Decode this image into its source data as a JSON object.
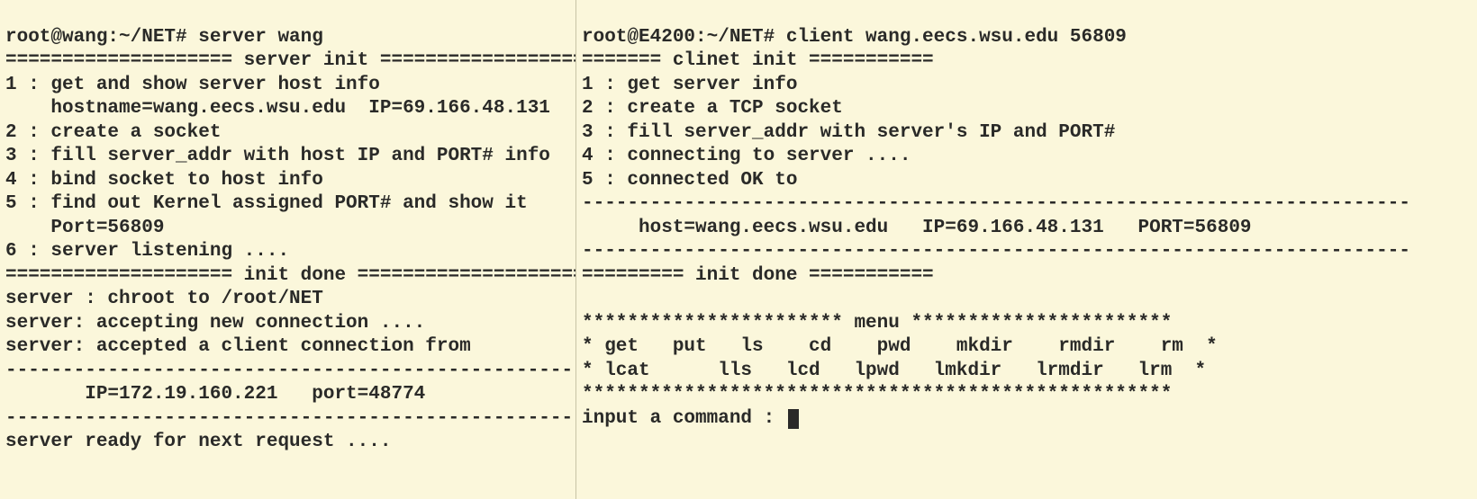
{
  "server": {
    "prompt": "root@wang:~/NET# server wang",
    "init_header": "==================== server init ===================",
    "steps": {
      "s1a": "1 : get and show server host info",
      "s1b": "    hostname=wang.eecs.wsu.edu  IP=69.166.48.131",
      "s2": "2 : create a socket",
      "s3": "3 : fill server_addr with host IP and PORT# info",
      "s4": "4 : bind socket to host info",
      "s5a": "5 : find out Kernel assigned PORT# and show it",
      "s5b": "    Port=56809",
      "s6": "6 : server listening ...."
    },
    "init_done": "==================== init done ====================",
    "chroot": "server : chroot to /root/NET",
    "accepting": "server: accepting new connection ....",
    "accepted": "server: accepted a client connection from",
    "dashes1": "---------------------------------------------------",
    "client_ip": "       IP=172.19.160.221   port=48774",
    "dashes2": "---------------------------------------------------",
    "ready": "server ready for next request ...."
  },
  "client": {
    "prompt": "root@E4200:~/NET# client wang.eecs.wsu.edu 56809",
    "init_header": "======= clinet init ===========",
    "steps": {
      "s1": "1 : get server info",
      "s2": "2 : create a TCP socket",
      "s3": "3 : fill server_addr with server's IP and PORT#",
      "s4": "4 : connecting to server ....",
      "s5": "5 : connected OK to"
    },
    "dashes1": "-------------------------------------------------------------------------",
    "host_line": "     host=wang.eecs.wsu.edu   IP=69.166.48.131   PORT=56809",
    "dashes2": "-------------------------------------------------------------------------",
    "init_done": "========= init done ===========",
    "blank": "",
    "menu_header": "*********************** menu ***********************",
    "menu_row1": "* get   put   ls    cd    pwd    mkdir    rmdir    rm  *",
    "menu_row2": "* lcat      lls   lcd   lpwd   lmkdir   lrmdir   lrm  *",
    "menu_footer": "****************************************************",
    "input_prompt": "input a command : "
  }
}
